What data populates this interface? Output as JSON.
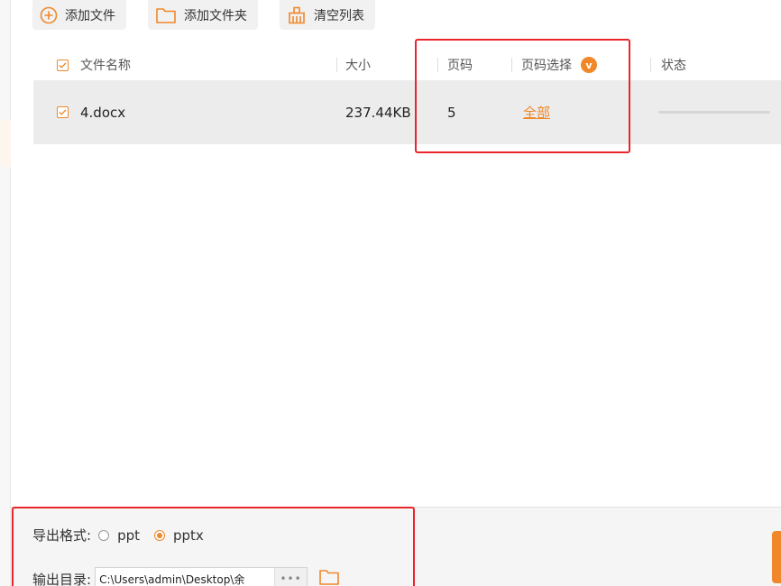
{
  "toolbar": {
    "add_file": "添加文件",
    "add_folder": "添加文件夹",
    "clear_list": "清空列表"
  },
  "table": {
    "headers": {
      "name": "文件名称",
      "size": "大小",
      "pages": "页码",
      "page_select": "页码选择",
      "page_select_badge": "v",
      "status": "状态"
    },
    "rows": [
      {
        "checked": true,
        "name": "4.docx",
        "size": "237.44KB",
        "pages": "5",
        "page_select": "全部",
        "progress": 0
      }
    ]
  },
  "export": {
    "format_label": "导出格式:",
    "options": [
      "ppt",
      "pptx"
    ],
    "selected": "pptx",
    "dir_label": "输出目录:",
    "dir_value": "C:\\Users\\admin\\Desktop\\余",
    "dir_more": "•••"
  },
  "colors": {
    "accent": "#f0882a",
    "highlight": "#e8262b"
  }
}
